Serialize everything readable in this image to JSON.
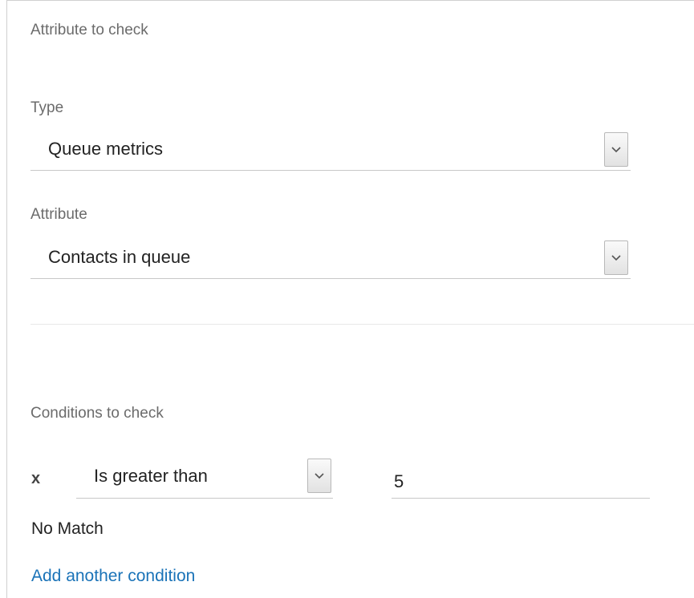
{
  "attribute_section": {
    "title": "Attribute to check",
    "type_field": {
      "label": "Type",
      "value": "Queue metrics"
    },
    "attribute_field": {
      "label": "Attribute",
      "value": "Contacts in queue"
    }
  },
  "conditions_section": {
    "title": "Conditions to check",
    "condition": {
      "remove_label": "x",
      "operator": "Is greater than",
      "value": "5"
    },
    "no_match_label": "No Match",
    "add_condition_label": "Add another condition"
  },
  "icons": {
    "dropdown": "chevron-down-icon"
  },
  "colors": {
    "link": "#1a73b8",
    "label": "#6b6b6b",
    "text": "#222222"
  }
}
